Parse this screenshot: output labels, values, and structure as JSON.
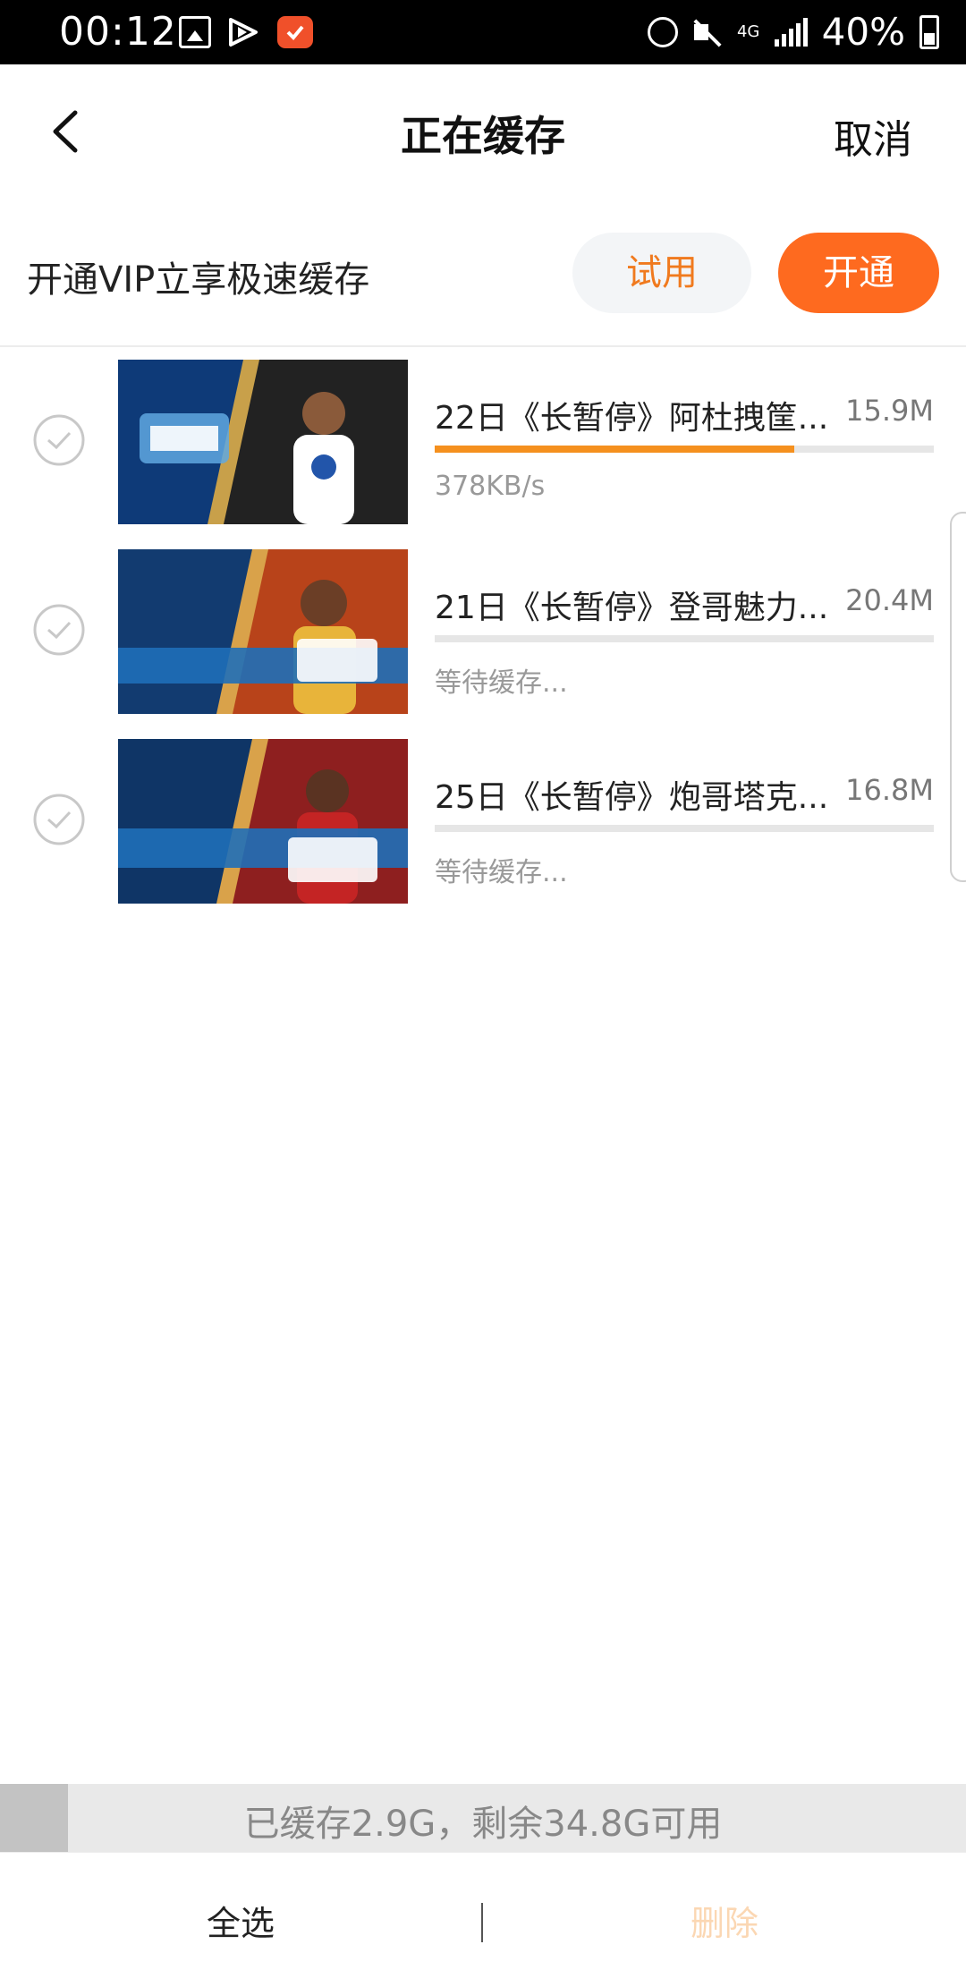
{
  "status_bar": {
    "time": "00:12",
    "network": "4G",
    "battery": "40%",
    "icons": [
      "gallery-icon",
      "play-icon",
      "app-notification-icon",
      "alarm-icon",
      "mute-icon",
      "signal-icon",
      "battery-icon"
    ]
  },
  "header": {
    "title": "正在缓存",
    "cancel_label": "取消"
  },
  "vip_banner": {
    "text": "开通VIP立享极速缓存",
    "trial_label": "试用",
    "open_label": "开通"
  },
  "downloads": [
    {
      "title": "22日《长暂停》阿杜拽筐...",
      "size": "15.9M",
      "status": "378KB/s",
      "progress": 0.72
    },
    {
      "title": "21日《长暂停》登哥魅力...",
      "size": "20.4M",
      "status": "等待缓存...",
      "progress": 0
    },
    {
      "title": "25日《长暂停》炮哥塔克...",
      "size": "16.8M",
      "status": "等待缓存...",
      "progress": 0
    }
  ],
  "storage": {
    "text": "已缓存2.9G，剩余34.8G可用",
    "used_fraction": 0.07
  },
  "bottom_bar": {
    "select_all_label": "全选",
    "delete_label": "删除"
  },
  "colors": {
    "accent": "#fe6a1f",
    "progress": "#f5901e",
    "trial_text": "#f07a1e",
    "delete_disabled": "#fbd7b3"
  }
}
